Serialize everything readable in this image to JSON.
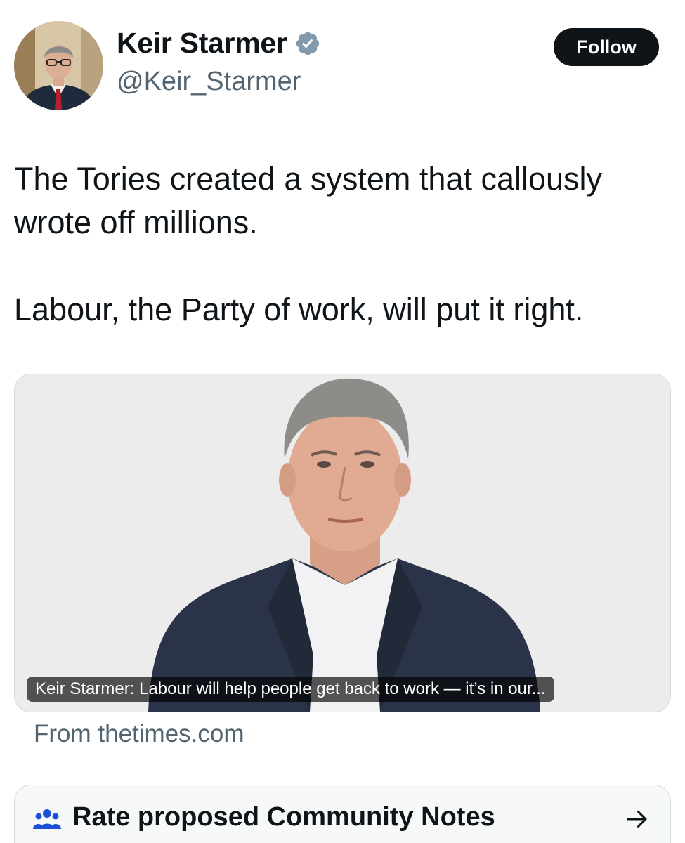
{
  "author": {
    "display_name": "Keir Starmer",
    "handle": "@Keir_Starmer",
    "verified": true,
    "verified_color": "#829aab"
  },
  "follow_button": {
    "label": "Follow"
  },
  "tweet": {
    "paragraph_1": "The Tories created a system that callously wrote off millions.",
    "paragraph_2": "Labour, the Party of work, will put it right."
  },
  "link_card": {
    "caption": "Keir Starmer: Labour will help people get back to work — it’s in our...",
    "source": "From thetimes.com"
  },
  "community_notes": {
    "label": "Rate proposed Community Notes",
    "icon": "people-icon",
    "arrow": "arrow-right-icon"
  }
}
